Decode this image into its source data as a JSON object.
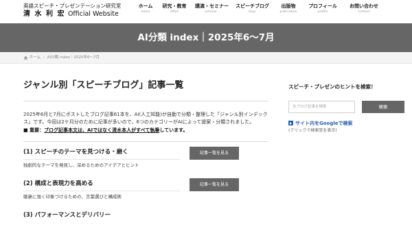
{
  "header": {
    "logo_line1": "英語スピーチ・プレゼンテーション研究室",
    "logo_name": "清 水 利 宏",
    "logo_sub": "Official Website"
  },
  "nav": {
    "items": [
      {
        "ja": "ホーム",
        "en": "home"
      },
      {
        "ja": "研究・教育",
        "en": "office"
      },
      {
        "ja": "講演・セミナー",
        "en": "seminar"
      },
      {
        "ja": "スピーチブログ",
        "en": "blog"
      },
      {
        "ja": "出版物",
        "en": "publication"
      },
      {
        "ja": "プロフィール",
        "en": "profile"
      },
      {
        "ja": "お問い合わせ",
        "en": "contact"
      }
    ]
  },
  "page": {
    "title": "AI分類 index｜2025年6〜7月"
  },
  "breadcrumb": {
    "home": "ホーム",
    "separator": "›",
    "current": "AI分類 index｜2025年6〜7月"
  },
  "main": {
    "heading": "ジャンル別「スピーチブログ」記事一覧",
    "intro": "2025年6月と7月にポストしたブログ記事61本を、AI(人工知能)が自動で分類・整理した「ジャンル別インデックス」です。今回は2ケ月分のために記事が多いので、6つのカテゴリーがAIによって提案・分類されました。",
    "notice_prefix": "■ 重要：",
    "notice_underlined": "ブログ記事本文は、AIではなく清水本人がすべて執筆",
    "notice_suffix": "しています。",
    "categories": [
      {
        "title": "(1) スピーチのテーマを見つける・磨く",
        "desc": "独創的なテーマを発見し、深めるためのアイデアとヒント",
        "button": "記事一覧を見る"
      },
      {
        "title": "(2) 構成と表現力を高める",
        "desc": "聴衆に強く印象づけるための、言葉選びと構成術",
        "button": "記事一覧を見る"
      },
      {
        "title": "(3) パフォーマンスとデリバリー",
        "desc": "",
        "button": ""
      }
    ]
  },
  "sidebar": {
    "heading": "スピーチ・プレゼンのヒントを検索！",
    "search_placeholder": "全ブログ記事を検索",
    "search_button": "検索",
    "google_link": "サイト内をGoogleで検索",
    "google_note": "(クリックで検索窓を表示)"
  },
  "colors": {
    "band": "#666666",
    "button": "#666666",
    "link": "#2a5fb0"
  }
}
